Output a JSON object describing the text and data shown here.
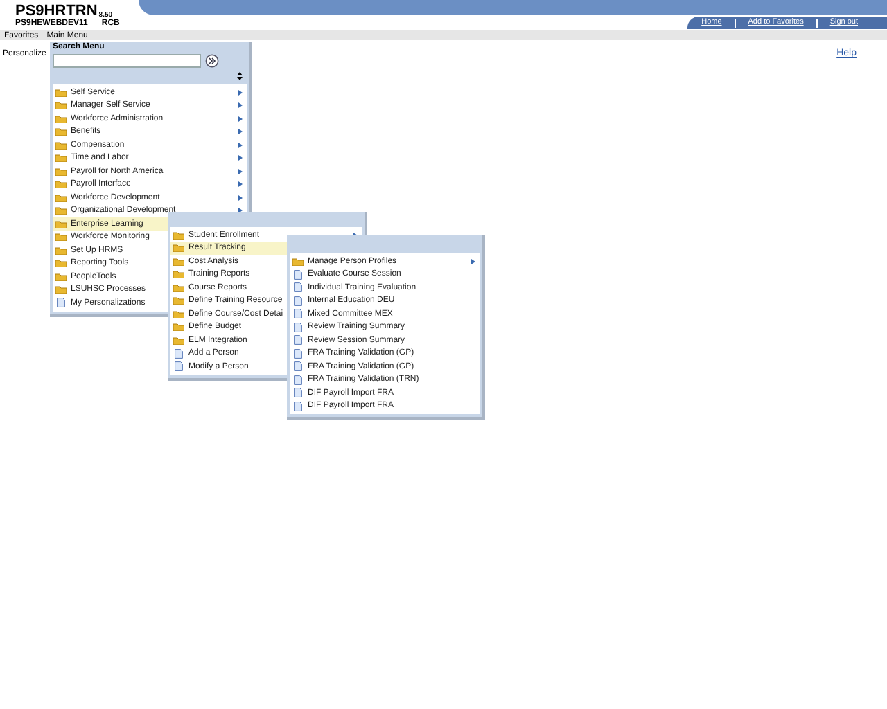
{
  "header": {
    "title": "PS9HRTRN",
    "version": "8.50",
    "server": "PS9HEWEBDEV11",
    "user": "RCB",
    "links": [
      "Home",
      "Add to Favorites",
      "Sign out"
    ]
  },
  "nav": [
    {
      "label": "Favorites"
    },
    {
      "label": "Main Menu"
    }
  ],
  "page": {
    "personalize": "Personalize",
    "help": "Help"
  },
  "menus": [
    {
      "title": "Search Menu",
      "items": [
        {
          "label": "Self Service",
          "kind": "folder",
          "arrow": true,
          "selected": false
        },
        {
          "label": "Manager Self Service",
          "kind": "folder",
          "arrow": true,
          "selected": false
        },
        {
          "label": "Workforce Administration",
          "kind": "folder",
          "arrow": true,
          "selected": false
        },
        {
          "label": "Benefits",
          "kind": "folder",
          "arrow": true,
          "selected": false
        },
        {
          "label": "Compensation",
          "kind": "folder",
          "arrow": true,
          "selected": false
        },
        {
          "label": "Time and Labor",
          "kind": "folder",
          "arrow": true,
          "selected": false
        },
        {
          "label": "Payroll for North America",
          "kind": "folder",
          "arrow": true,
          "selected": false
        },
        {
          "label": "Payroll Interface",
          "kind": "folder",
          "arrow": true,
          "selected": false
        },
        {
          "label": "Workforce Development",
          "kind": "folder",
          "arrow": true,
          "selected": false
        },
        {
          "label": "Organizational Development",
          "kind": "folder",
          "arrow": true,
          "selected": false
        },
        {
          "label": "Enterprise Learning",
          "kind": "folder",
          "arrow": false,
          "selected": true
        },
        {
          "label": "Workforce Monitoring",
          "kind": "folder",
          "arrow": false,
          "selected": false
        },
        {
          "label": "Set Up HRMS",
          "kind": "folder",
          "arrow": false,
          "selected": false
        },
        {
          "label": "Reporting Tools",
          "kind": "folder",
          "arrow": false,
          "selected": false
        },
        {
          "label": "PeopleTools",
          "kind": "folder",
          "arrow": false,
          "selected": false
        },
        {
          "label": "LSUHSC Processes",
          "kind": "folder",
          "arrow": false,
          "selected": false
        },
        {
          "label": "My Personalizations",
          "kind": "page",
          "arrow": false,
          "selected": false
        }
      ]
    },
    {
      "items": [
        {
          "label": "Student Enrollment",
          "kind": "folder",
          "arrow": true,
          "selected": false
        },
        {
          "label": "Result Tracking",
          "kind": "folder",
          "arrow": false,
          "selected": true
        },
        {
          "label": "Cost Analysis",
          "kind": "folder",
          "arrow": false,
          "selected": false
        },
        {
          "label": "Training Reports",
          "kind": "folder",
          "arrow": false,
          "selected": false
        },
        {
          "label": "Course Reports",
          "kind": "folder",
          "arrow": false,
          "selected": false
        },
        {
          "label": "Define Training Resource",
          "kind": "folder",
          "arrow": false,
          "selected": false
        },
        {
          "label": "Define Course/Cost Detai",
          "kind": "folder",
          "arrow": false,
          "selected": false
        },
        {
          "label": "Define Budget",
          "kind": "folder",
          "arrow": false,
          "selected": false
        },
        {
          "label": "ELM Integration",
          "kind": "folder",
          "arrow": false,
          "selected": false
        },
        {
          "label": "Add a Person",
          "kind": "page",
          "arrow": false,
          "selected": false
        },
        {
          "label": "Modify a Person",
          "kind": "page",
          "arrow": false,
          "selected": false
        }
      ]
    },
    {
      "items": [
        {
          "label": "Manage Person Profiles",
          "kind": "folder",
          "arrow": true,
          "selected": false
        },
        {
          "label": "Evaluate Course Session",
          "kind": "page",
          "arrow": false,
          "selected": false
        },
        {
          "label": "Individual Training Evaluation",
          "kind": "page",
          "arrow": false,
          "selected": false
        },
        {
          "label": "Internal Education DEU",
          "kind": "page",
          "arrow": false,
          "selected": false
        },
        {
          "label": "Mixed Committee MEX",
          "kind": "page",
          "arrow": false,
          "selected": false
        },
        {
          "label": "Review Training Summary",
          "kind": "page",
          "arrow": false,
          "selected": false
        },
        {
          "label": "Review Session Summary",
          "kind": "page",
          "arrow": false,
          "selected": false
        },
        {
          "label": "FRA Training Validation (GP)",
          "kind": "page",
          "arrow": false,
          "selected": false
        },
        {
          "label": "FRA Training Validation (GP)",
          "kind": "page",
          "arrow": false,
          "selected": false
        },
        {
          "label": "FRA Training Validation (TRN)",
          "kind": "page",
          "arrow": false,
          "selected": false
        },
        {
          "label": "DIF Payroll Import FRA",
          "kind": "page",
          "arrow": false,
          "selected": false
        },
        {
          "label": "DIF Payroll Import FRA",
          "kind": "page",
          "arrow": false,
          "selected": false
        }
      ]
    }
  ]
}
